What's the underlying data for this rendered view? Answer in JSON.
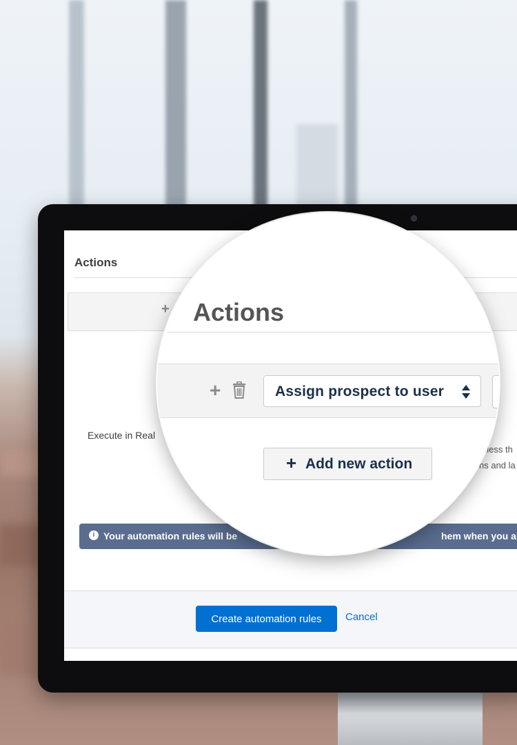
{
  "page": {
    "section_title": "Actions",
    "execute_label": "Execute in Real",
    "right_fragment_1": "nless th",
    "right_fragment_2": "ns and la",
    "info_message_start": "Your automation rules will be",
    "info_message_end": "hem when you are read",
    "create_button": "Create automation rules",
    "cancel_link": "Cancel",
    "small_plus": "+"
  },
  "magnifier": {
    "title": "Actions",
    "action_select_value": "Assign prospect to user",
    "add_button_label": "Add new action",
    "plus": "+"
  },
  "colors": {
    "primary_button": "#0070d2",
    "info_bar": "#5a6d8f",
    "select_text": "#1a3049"
  },
  "icons": [
    "plus-icon",
    "trash-icon",
    "select-arrows-icon",
    "info-icon",
    "camera-icon"
  ]
}
